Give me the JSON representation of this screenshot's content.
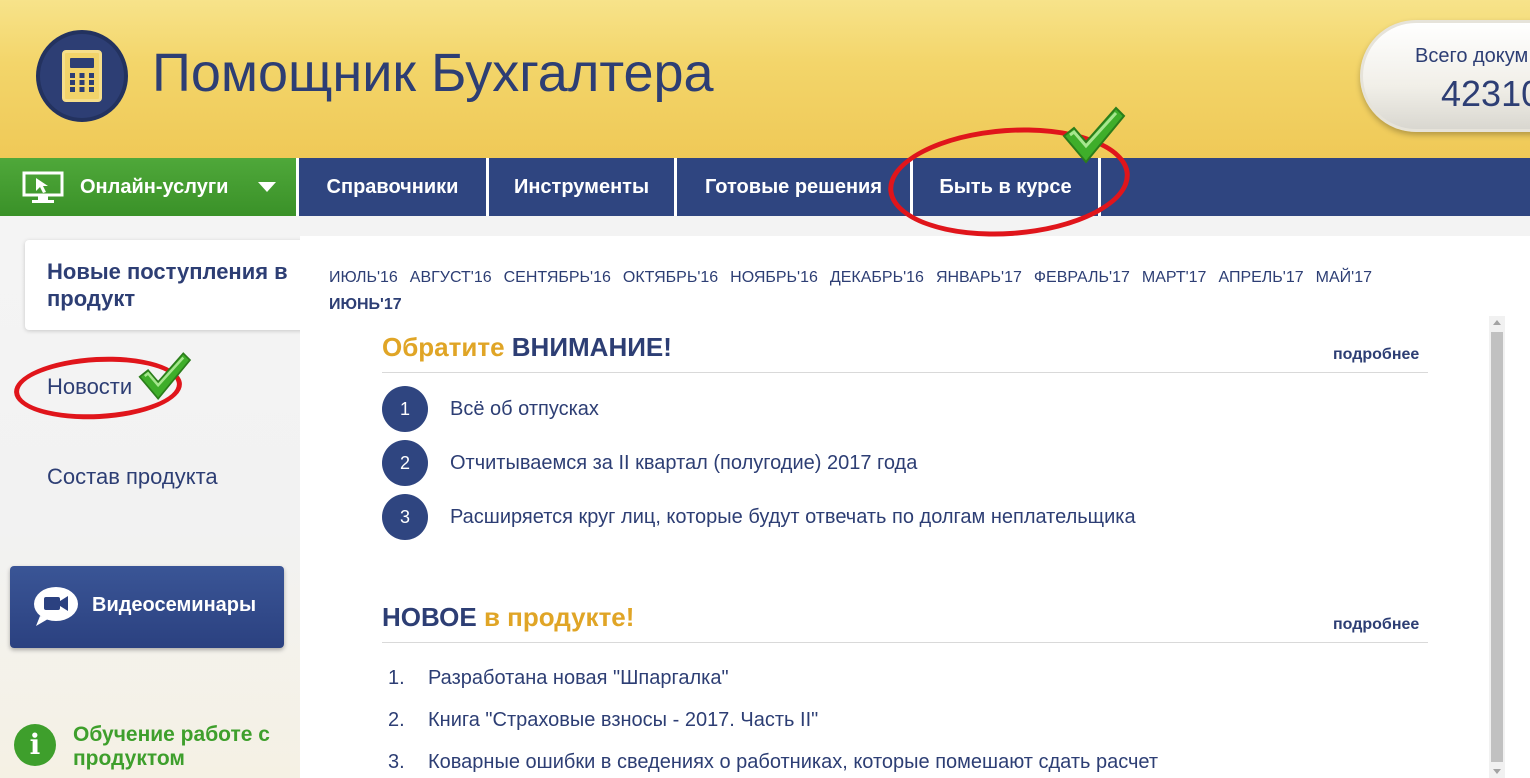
{
  "header": {
    "brand": "Помощник Бухгалтера",
    "counter_label": "Всего докум",
    "counter_value": "42310"
  },
  "nav": {
    "online": "Онлайн-услуги",
    "ref": "Справочники",
    "tools": "Инструменты",
    "ready": "Готовые решения",
    "news": "Быть в курсе"
  },
  "sidebar": {
    "active": "Новые поступления в продукт",
    "news": "Новости",
    "composition": "Состав продукта",
    "video": "Видеосеминары",
    "learn": "Обучение работе с продуктом"
  },
  "months": [
    "ИЮЛЬ'16",
    "АВГУСТ'16",
    "СЕНТЯБРЬ'16",
    "ОКТЯБРЬ'16",
    "НОЯБРЬ'16",
    "ДЕКАБРЬ'16",
    "ЯНВАРЬ'17",
    "ФЕВРАЛЬ'17",
    "МАРТ'17",
    "АПРЕЛЬ'17",
    "МАЙ'17",
    "ИЮНЬ'17"
  ],
  "attention": {
    "title_part1": "Обратите",
    "title_part2": "ВНИМАНИЕ!",
    "more": "подробнее",
    "items": [
      {
        "num": "1",
        "text": "Всё об отпусках"
      },
      {
        "num": "2",
        "text": "Отчитываемся за II квартал (полугодие) 2017 года"
      },
      {
        "num": "3",
        "text": "Расширяется круг лиц, которые будут отвечать по долгам неплательщика"
      }
    ]
  },
  "new_section": {
    "title_part1": "НОВОЕ",
    "title_part2": "в продукте!",
    "more": "подробнее",
    "items": [
      {
        "num": "1.",
        "text": "Разработана новая \"Шпаргалка\""
      },
      {
        "num": "2.",
        "text": "Книга \"Страховые взносы - 2017. Часть II\""
      },
      {
        "num": "3.",
        "text": "Коварные ошибки в сведениях о работниках, которые помешают сдать расчет"
      }
    ]
  },
  "colors": {
    "navy": "#2d3e74",
    "gold": "#e0a526",
    "green": "#3e9f2c",
    "nav_bg": "#2f4580",
    "highlight_red": "#e0151b"
  }
}
